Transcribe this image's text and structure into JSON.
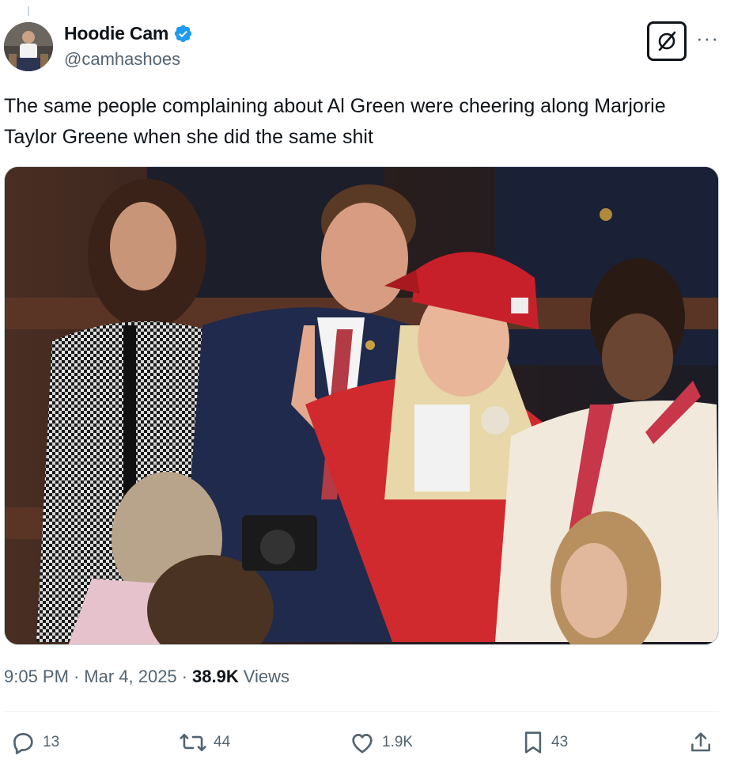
{
  "author": {
    "display_name": "Hoodie Cam",
    "handle": "@camhashoes",
    "verified": true,
    "verified_color": "#1d9bf0"
  },
  "tweet": {
    "text": "The same people complaining about Al Green were cheering along Marjorie Taylor Greene when she did the same shit"
  },
  "meta": {
    "time": "9:05 PM",
    "date": "Mar 4, 2025",
    "views_count": "38.9K",
    "views_label": "Views"
  },
  "actions": {
    "replies": "13",
    "reposts": "44",
    "likes": "1.9K",
    "bookmarks": "43"
  },
  "icons": {
    "verified": "verified-badge-icon",
    "grok": "grok-icon",
    "more": "more-icon",
    "reply": "reply-icon",
    "repost": "repost-icon",
    "like": "heart-icon",
    "bookmark": "bookmark-icon",
    "share": "share-icon"
  },
  "colors": {
    "text_primary": "#0f1419",
    "text_secondary": "#536471",
    "divider": "#eff3f4",
    "hat_red": "#c8202a"
  }
}
